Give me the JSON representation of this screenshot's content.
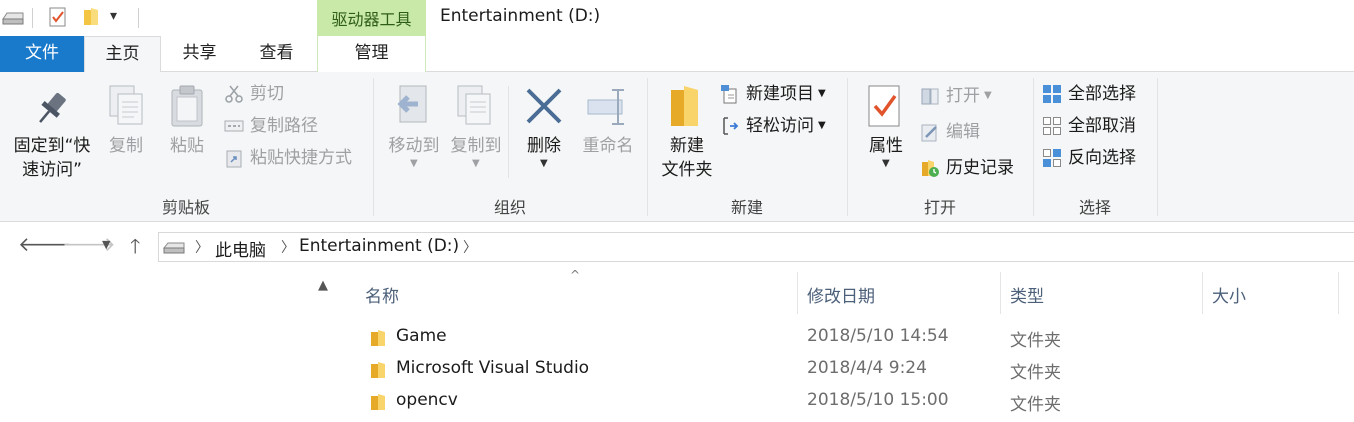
{
  "window": {
    "title": "Entertainment (D:)",
    "context_tab_group": "驱动器工具"
  },
  "tabs": [
    {
      "label": "文件"
    },
    {
      "label": "主页"
    },
    {
      "label": "共享"
    },
    {
      "label": "查看"
    },
    {
      "label": "管理"
    }
  ],
  "ribbon": {
    "clipboard": {
      "group_label": "剪贴板",
      "pin_label_line1": "固定到“快",
      "pin_label_line2": "速访问”",
      "copy_label": "复制",
      "paste_label": "粘贴",
      "cut_label": "剪切",
      "copy_path_label": "复制路径",
      "paste_shortcut_label": "粘贴快捷方式"
    },
    "organize": {
      "group_label": "组织",
      "move_to_label": "移动到",
      "copy_to_label": "复制到",
      "delete_label": "删除",
      "rename_label": "重命名"
    },
    "new": {
      "group_label": "新建",
      "new_folder_line1": "新建",
      "new_folder_line2": "文件夹",
      "new_item_label": "新建项目",
      "easy_access_label": "轻松访问"
    },
    "open": {
      "group_label": "打开",
      "properties_label": "属性",
      "open_label": "打开",
      "edit_label": "编辑",
      "history_label": "历史记录"
    },
    "select": {
      "group_label": "选择",
      "select_all_label": "全部选择",
      "select_none_label": "全部取消",
      "invert_label": "反向选择"
    }
  },
  "address": {
    "crumbs": [
      "此电脑",
      "Entertainment (D:)"
    ]
  },
  "columns": {
    "name": "名称",
    "date": "修改日期",
    "type": "类型",
    "size": "大小"
  },
  "files": [
    {
      "name": "Game",
      "date": "2018/5/10 14:54",
      "type": "文件夹"
    },
    {
      "name": "Microsoft Visual Studio",
      "date": "2018/4/4 9:24",
      "type": "文件夹"
    },
    {
      "name": "opencv",
      "date": "2018/5/10 15:00",
      "type": "文件夹"
    }
  ],
  "colors": {
    "file_tab": "#1979ca",
    "context_tab": "#c8e9a8",
    "folder": "#f4c542"
  }
}
